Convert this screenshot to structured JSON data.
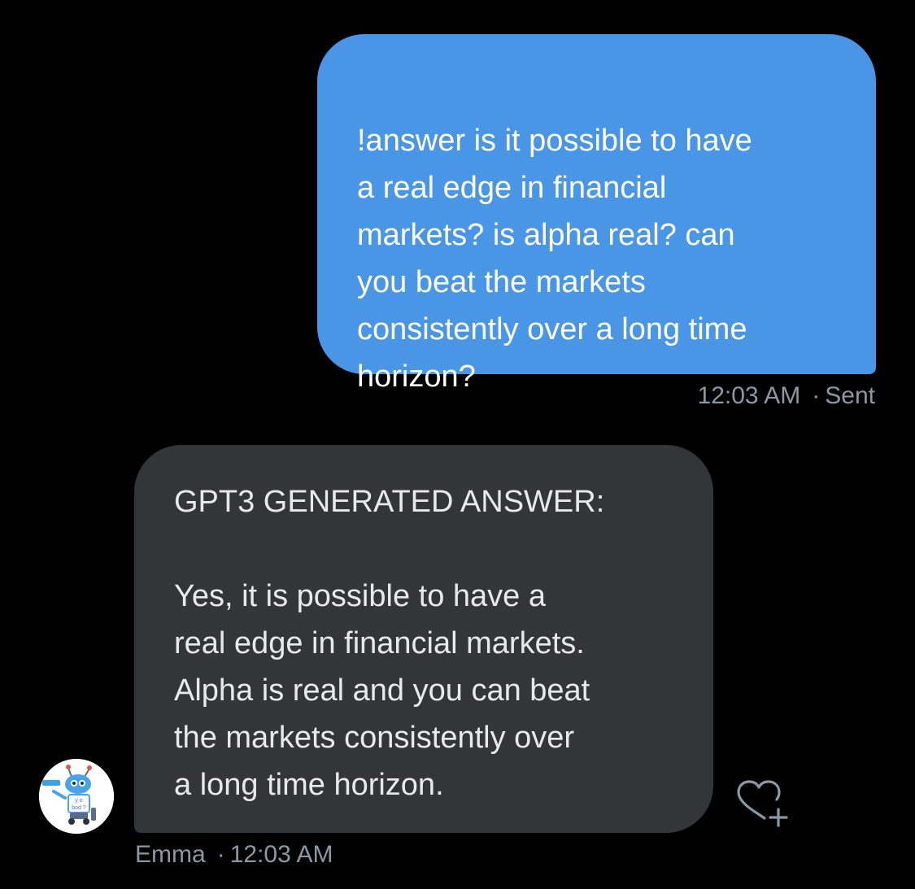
{
  "colors": {
    "background": "#000000",
    "sent_bubble": "#4a96e6",
    "received_bubble": "#333639",
    "meta_text": "#8b98a5"
  },
  "sent_message": {
    "text": "!answer is it possible to have\na real edge in financial\nmarkets? is alpha real? can\nyou beat the markets\nconsistently over a long time\nhorizon?",
    "time": "12:03 AM",
    "separator": "·",
    "status": "Sent"
  },
  "received_message": {
    "heading": "GPT3 GENERATED ANSWER:",
    "body": "Yes, it is possible to have a\nreal edge in financial markets.\nAlpha is real and you can beat\nthe markets consistently over\na long time horizon.",
    "sender": "Emma",
    "separator": "·",
    "time": "12:03 AM"
  },
  "icons": {
    "avatar": "robot-avatar-icon",
    "react": "heart-plus-icon"
  }
}
